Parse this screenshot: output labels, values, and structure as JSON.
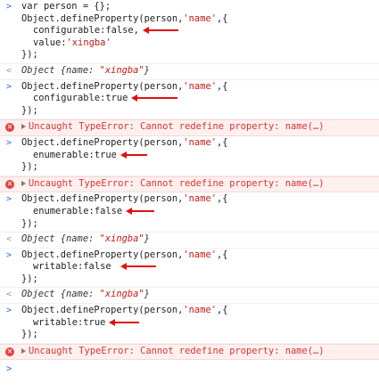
{
  "gutter": {
    "input": ">",
    "output": "<"
  },
  "entries": [
    {
      "lines": [
        "var person = {};",
        "Object.defineProperty(person,'name',{",
        "configurable:false,",
        "value:'xingba'",
        "});"
      ]
    },
    {
      "output": "Object {name: \"xingba\"}"
    },
    {
      "lines": [
        "Object.defineProperty(person,'name',{",
        "configurable:true",
        "});"
      ]
    },
    {
      "error": "Uncaught TypeError: Cannot redefine property: name(…)"
    },
    {
      "lines": [
        "Object.defineProperty(person,'name',{",
        "enumerable:true",
        "});"
      ]
    },
    {
      "error": "Uncaught TypeError: Cannot redefine property: name(…)"
    },
    {
      "lines": [
        "Object.defineProperty(person,'name',{",
        "enumerable:false",
        "});"
      ]
    },
    {
      "output": "Object {name: \"xingba\"}"
    },
    {
      "lines": [
        "Object.defineProperty(person,'name',{",
        "writable:false",
        "});"
      ]
    },
    {
      "output": "Object {name: \"xingba\"}"
    },
    {
      "lines": [
        "Object.defineProperty(person,'name',{",
        "writable:true",
        "});"
      ]
    },
    {
      "error": "Uncaught TypeError: Cannot redefine property: name(…)"
    }
  ],
  "colors": {
    "annotation_arrow": "#e01010",
    "error_text": "#d8352f",
    "error_bg": "#fff0f0",
    "prompt": "#2a6fd6",
    "string": "#c41a16"
  }
}
